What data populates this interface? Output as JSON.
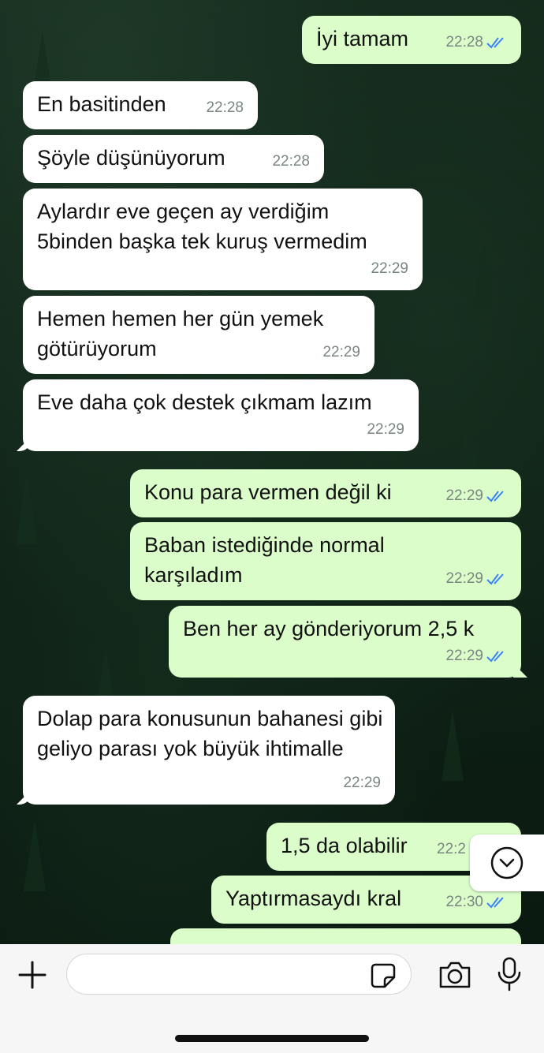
{
  "messages": [
    {
      "dir": "out",
      "text": "İyi tamam",
      "time": "22:28",
      "read": true
    },
    {
      "dir": "in",
      "text": "En basitinden",
      "time": "22:28"
    },
    {
      "dir": "in",
      "text": "Şöyle düşünüyorum",
      "time": "22:28"
    },
    {
      "dir": "in",
      "text": "Aylardır eve geçen ay verdiğim 5binden başka tek kuruş vermedim",
      "time": "22:29"
    },
    {
      "dir": "in",
      "text": "Hemen hemen her gün yemek götürüyorum",
      "time": "22:29"
    },
    {
      "dir": "in",
      "text": "Eve daha çok destek çıkmam lazım",
      "time": "22:29"
    },
    {
      "dir": "out",
      "text": "Konu para vermen değil ki",
      "time": "22:29",
      "read": true
    },
    {
      "dir": "out",
      "text": "Baban istediğinde normal karşıladım",
      "time": "22:29",
      "read": true
    },
    {
      "dir": "out",
      "text": "Ben her ay gönderiyorum 2,5 k",
      "time": "22:29",
      "read": true
    },
    {
      "dir": "in",
      "text": "Dolap para konusunun bahanesi gibi geliyo parası yok büyük ihtimalle",
      "time": "22:29"
    },
    {
      "dir": "out",
      "text": "1,5 da olabilir",
      "time": "22:2"
    },
    {
      "dir": "out",
      "text": "Yaptırmasaydı kral",
      "time": "22:30",
      "read": true
    }
  ],
  "input": {
    "placeholder": ""
  },
  "icons": {
    "add": "plus-icon",
    "sticker": "sticker-icon",
    "camera": "camera-icon",
    "mic": "microphone-icon",
    "scroll": "chevron-down-icon"
  },
  "colors": {
    "incoming": "#ffffff",
    "outgoing": "#dbfdca",
    "read_ticks": "#3b82f6"
  }
}
